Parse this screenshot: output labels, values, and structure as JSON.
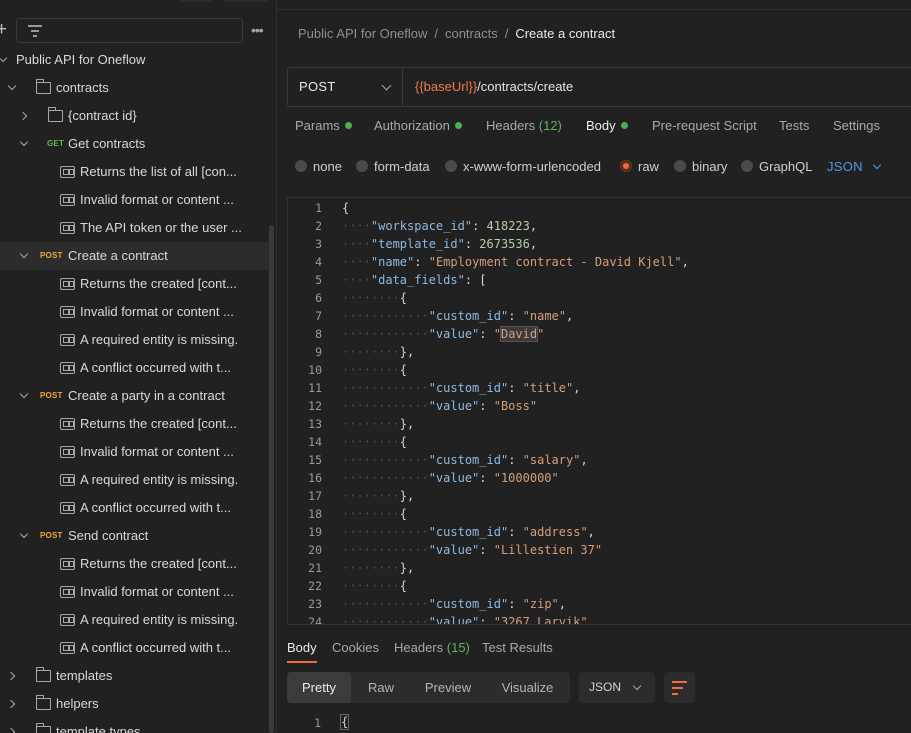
{
  "sidebar": {
    "more_label": "•••",
    "tree": [
      {
        "label": "Public API for Oneflow",
        "kind": "collection",
        "chevron": "down",
        "depth": 0
      },
      {
        "label": "contracts",
        "kind": "folder",
        "chevron": "down",
        "depth": 1
      },
      {
        "label": "{contract id}",
        "kind": "folder",
        "chevron": "right",
        "depth": 2
      },
      {
        "label": "Get contracts",
        "kind": "request",
        "method": "GET",
        "chevron": "down",
        "depth": 2
      },
      {
        "label": "Returns the list of all [con...",
        "kind": "example",
        "depth": 3
      },
      {
        "label": "Invalid format or content ...",
        "kind": "example",
        "depth": 3
      },
      {
        "label": "The API token or the user ...",
        "kind": "example",
        "depth": 3
      },
      {
        "label": "Create a contract",
        "kind": "request",
        "method": "POST",
        "chevron": "down",
        "depth": 2,
        "selected": true
      },
      {
        "label": "Returns the created [cont...",
        "kind": "example",
        "depth": 3
      },
      {
        "label": "Invalid format or content ...",
        "kind": "example",
        "depth": 3
      },
      {
        "label": "A required entity is missing.",
        "kind": "example",
        "depth": 3
      },
      {
        "label": "A conflict occurred with t...",
        "kind": "example",
        "depth": 3
      },
      {
        "label": "Create a party in a contract",
        "kind": "request",
        "method": "POST",
        "chevron": "down",
        "depth": 2
      },
      {
        "label": "Returns the created [cont...",
        "kind": "example",
        "depth": 3
      },
      {
        "label": "Invalid format or content ...",
        "kind": "example",
        "depth": 3
      },
      {
        "label": "A required entity is missing.",
        "kind": "example",
        "depth": 3
      },
      {
        "label": "A conflict occurred with t...",
        "kind": "example",
        "depth": 3
      },
      {
        "label": "Send contract",
        "kind": "request",
        "method": "POST",
        "chevron": "down",
        "depth": 2
      },
      {
        "label": "Returns the created [cont...",
        "kind": "example",
        "depth": 3
      },
      {
        "label": "Invalid format or content ...",
        "kind": "example",
        "depth": 3
      },
      {
        "label": "A required entity is missing.",
        "kind": "example",
        "depth": 3
      },
      {
        "label": "A conflict occurred with t...",
        "kind": "example",
        "depth": 3
      },
      {
        "label": "templates",
        "kind": "folder",
        "chevron": "right",
        "depth": 1
      },
      {
        "label": "helpers",
        "kind": "folder",
        "chevron": "right",
        "depth": 1
      },
      {
        "label": "template types",
        "kind": "folder",
        "chevron": "right",
        "depth": 1
      }
    ]
  },
  "breadcrumb": {
    "items": [
      "Public API for Oneflow",
      "contracts"
    ],
    "separator": "/",
    "current": "Create a contract"
  },
  "request": {
    "method": "POST",
    "url_variable": "{{baseUrl}}",
    "url_path": "/contracts/create"
  },
  "request_tabs": [
    {
      "label": "Params",
      "dot": true
    },
    {
      "label": "Authorization",
      "dot": true
    },
    {
      "label": "Headers",
      "count": "(12)"
    },
    {
      "label": "Body",
      "dot": true,
      "active": true
    },
    {
      "label": "Pre-request Script"
    },
    {
      "label": "Tests"
    },
    {
      "label": "Settings"
    }
  ],
  "body_modes": {
    "options": [
      "none",
      "form-data",
      "x-www-form-urlencoded",
      "raw",
      "binary",
      "GraphQL"
    ],
    "selected": "raw",
    "language": "JSON"
  },
  "editor": {
    "lines": [
      {
        "n": "1",
        "indent": 0,
        "parts": [
          [
            "p",
            "{"
          ]
        ]
      },
      {
        "n": "2",
        "indent": 1,
        "parts": [
          [
            "k",
            "\"workspace_id\""
          ],
          [
            "p",
            ": "
          ],
          [
            "n",
            "418223"
          ],
          [
            "p",
            ","
          ]
        ]
      },
      {
        "n": "3",
        "indent": 1,
        "parts": [
          [
            "k",
            "\"template_id\""
          ],
          [
            "p",
            ": "
          ],
          [
            "n",
            "2673536"
          ],
          [
            "p",
            ","
          ]
        ]
      },
      {
        "n": "4",
        "indent": 1,
        "parts": [
          [
            "k",
            "\"name\""
          ],
          [
            "p",
            ": "
          ],
          [
            "s",
            "\"Employment contract - David Kjell\""
          ],
          [
            "p",
            ","
          ]
        ]
      },
      {
        "n": "5",
        "indent": 1,
        "parts": [
          [
            "k",
            "\"data_fields\""
          ],
          [
            "p",
            ": ["
          ]
        ]
      },
      {
        "n": "6",
        "indent": 2,
        "parts": [
          [
            "p",
            "{"
          ]
        ]
      },
      {
        "n": "7",
        "indent": 3,
        "parts": [
          [
            "k",
            "\"custom_id\""
          ],
          [
            "p",
            ": "
          ],
          [
            "s",
            "\"name\""
          ],
          [
            "p",
            ","
          ]
        ]
      },
      {
        "n": "8",
        "indent": 3,
        "parts": [
          [
            "k",
            "\"value\""
          ],
          [
            "p",
            ": "
          ],
          [
            "s",
            "\""
          ],
          [
            "h",
            "David"
          ],
          [
            "s",
            "\""
          ]
        ]
      },
      {
        "n": "9",
        "indent": 2,
        "parts": [
          [
            "p",
            "},"
          ]
        ]
      },
      {
        "n": "10",
        "indent": 2,
        "parts": [
          [
            "p",
            "{"
          ]
        ]
      },
      {
        "n": "11",
        "indent": 3,
        "parts": [
          [
            "k",
            "\"custom_id\""
          ],
          [
            "p",
            ": "
          ],
          [
            "s",
            "\"title\""
          ],
          [
            "p",
            ","
          ]
        ]
      },
      {
        "n": "12",
        "indent": 3,
        "parts": [
          [
            "k",
            "\"value\""
          ],
          [
            "p",
            ": "
          ],
          [
            "s",
            "\"Boss\""
          ]
        ]
      },
      {
        "n": "13",
        "indent": 2,
        "parts": [
          [
            "p",
            "},"
          ]
        ]
      },
      {
        "n": "14",
        "indent": 2,
        "parts": [
          [
            "p",
            "{"
          ]
        ]
      },
      {
        "n": "15",
        "indent": 3,
        "parts": [
          [
            "k",
            "\"custom_id\""
          ],
          [
            "p",
            ": "
          ],
          [
            "s",
            "\"salary\""
          ],
          [
            "p",
            ","
          ]
        ]
      },
      {
        "n": "16",
        "indent": 3,
        "parts": [
          [
            "k",
            "\"value\""
          ],
          [
            "p",
            ": "
          ],
          [
            "s",
            "\"1000000\""
          ]
        ]
      },
      {
        "n": "17",
        "indent": 2,
        "parts": [
          [
            "p",
            "},"
          ]
        ]
      },
      {
        "n": "18",
        "indent": 2,
        "parts": [
          [
            "p",
            "{"
          ]
        ]
      },
      {
        "n": "19",
        "indent": 3,
        "parts": [
          [
            "k",
            "\"custom_id\""
          ],
          [
            "p",
            ": "
          ],
          [
            "s",
            "\"address\""
          ],
          [
            "p",
            ","
          ]
        ]
      },
      {
        "n": "20",
        "indent": 3,
        "parts": [
          [
            "k",
            "\"value\""
          ],
          [
            "p",
            ": "
          ],
          [
            "s",
            "\"Lillestien 37\""
          ]
        ]
      },
      {
        "n": "21",
        "indent": 2,
        "parts": [
          [
            "p",
            "},"
          ]
        ]
      },
      {
        "n": "22",
        "indent": 2,
        "parts": [
          [
            "p",
            "{"
          ]
        ]
      },
      {
        "n": "23",
        "indent": 3,
        "parts": [
          [
            "k",
            "\"custom_id\""
          ],
          [
            "p",
            ": "
          ],
          [
            "s",
            "\"zip\""
          ],
          [
            "p",
            ","
          ]
        ]
      },
      {
        "n": "24",
        "indent": 3,
        "parts": [
          [
            "k",
            "\"value\""
          ],
          [
            "p",
            ": "
          ],
          [
            "s",
            "\"3267 Larvik\""
          ]
        ]
      }
    ]
  },
  "response": {
    "tabs": [
      {
        "label": "Body",
        "active": true
      },
      {
        "label": "Cookies"
      },
      {
        "label": "Headers",
        "count": "(15)"
      },
      {
        "label": "Test Results"
      }
    ],
    "views": [
      "Pretty",
      "Raw",
      "Preview",
      "Visualize"
    ],
    "active_view": "Pretty",
    "language": "JSON",
    "line_number": "1",
    "first_line": "{"
  },
  "colors": {
    "accent": "#f26b3a",
    "status_dot": "#4caf50",
    "get_method": "#6bb34a",
    "post_method": "#f4a638",
    "link_blue": "#4d9de0"
  }
}
